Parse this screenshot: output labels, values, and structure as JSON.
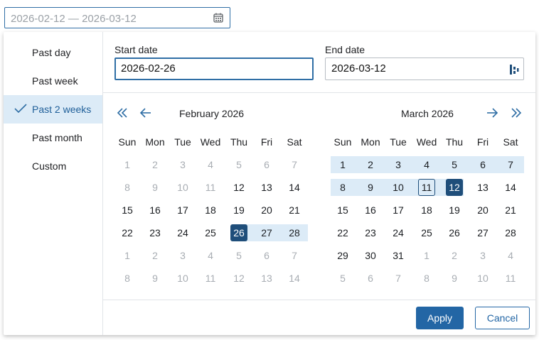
{
  "range_field": {
    "value": "2026-02-12 — 2026-03-12",
    "icon": "calendar-icon"
  },
  "presets": [
    {
      "label": "Past day",
      "selected": false
    },
    {
      "label": "Past week",
      "selected": false
    },
    {
      "label": "Past 2 weeks",
      "selected": true
    },
    {
      "label": "Past month",
      "selected": false
    },
    {
      "label": "Custom",
      "selected": false
    }
  ],
  "start_date": {
    "label": "Start date",
    "value": "2026-02-26"
  },
  "end_date": {
    "label": "End date",
    "value": "2026-03-12"
  },
  "weekdays": [
    "Sun",
    "Mon",
    "Tue",
    "Wed",
    "Thu",
    "Fri",
    "Sat"
  ],
  "calendars": [
    {
      "title": "February 2026",
      "weeks": [
        [
          "1",
          "2",
          "3",
          "4",
          "5",
          "6",
          "7"
        ],
        [
          "8",
          "9",
          "10",
          "11",
          "12",
          "13",
          "14"
        ],
        [
          "15",
          "16",
          "17",
          "18",
          "19",
          "20",
          "21"
        ],
        [
          "22",
          "23",
          "24",
          "25",
          "26",
          "27",
          "28"
        ],
        [
          "1",
          "2",
          "3",
          "4",
          "5",
          "6",
          "7"
        ],
        [
          "8",
          "9",
          "10",
          "11",
          "12",
          "13",
          "14"
        ]
      ],
      "range_start": "26",
      "today": null
    },
    {
      "title": "March 2026",
      "weeks": [
        [
          "1",
          "2",
          "3",
          "4",
          "5",
          "6",
          "7"
        ],
        [
          "8",
          "9",
          "10",
          "11",
          "12",
          "13",
          "14"
        ],
        [
          "15",
          "16",
          "17",
          "18",
          "19",
          "20",
          "21"
        ],
        [
          "22",
          "23",
          "24",
          "25",
          "26",
          "27",
          "28"
        ],
        [
          "29",
          "30",
          "31",
          "1",
          "2",
          "3",
          "4"
        ],
        [
          "5",
          "6",
          "7",
          "8",
          "9",
          "10",
          "11"
        ]
      ],
      "range_end": "12",
      "today": "11"
    }
  ],
  "buttons": {
    "apply": "Apply",
    "cancel": "Cancel"
  },
  "colors": {
    "accent": "#2366a5",
    "selected_day": "#1f4e7a",
    "range_band": "#dcebf7",
    "dimmed_text": "#a8adb3"
  }
}
